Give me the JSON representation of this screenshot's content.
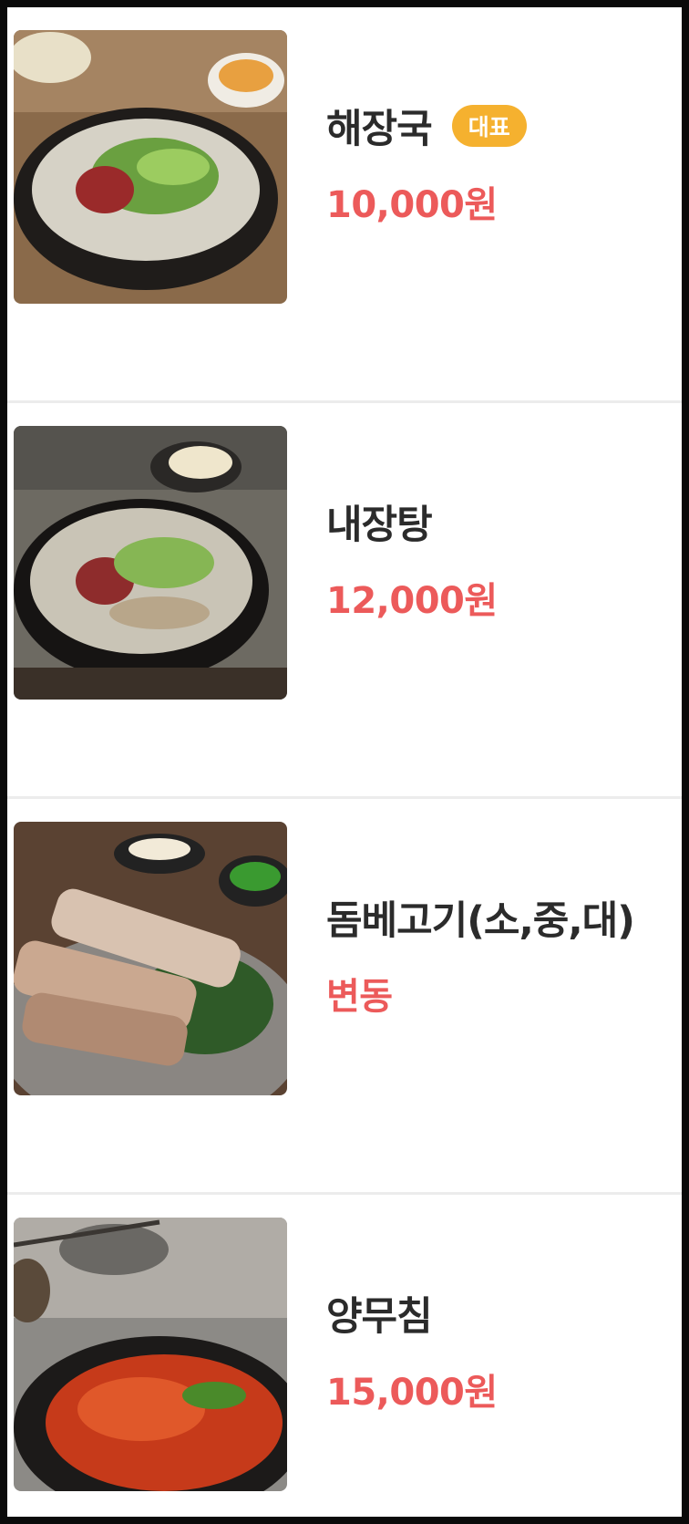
{
  "menu": {
    "items": [
      {
        "name": "해장국",
        "badge": "대표",
        "price": "10,000원",
        "image_icon": "haejangguk-soup-photo"
      },
      {
        "name": "내장탕",
        "price": "12,000원",
        "image_icon": "naejangtang-soup-photo"
      },
      {
        "name": "돔베고기(소,중,대)",
        "price": "변동",
        "image_icon": "dombe-pork-photo"
      },
      {
        "name": "양무침",
        "price": "15,000원",
        "image_icon": "yangmuchim-salad-photo"
      }
    ]
  },
  "colors": {
    "price": "#ec5a5a",
    "badge": "#f5b12f",
    "name": "#2b2b2b",
    "divider": "#ececec"
  }
}
